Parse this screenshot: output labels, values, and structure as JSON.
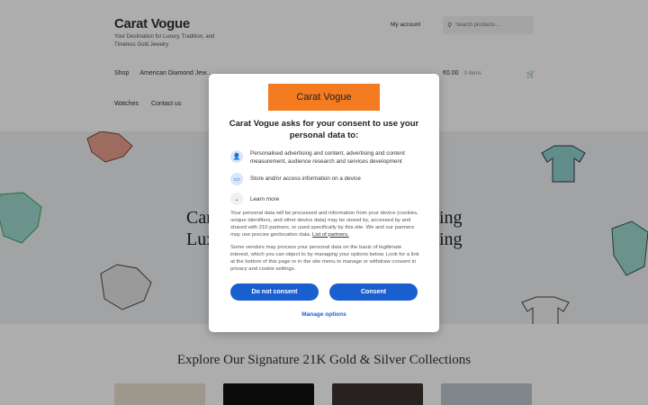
{
  "site": {
    "title": "Carat Vogue",
    "tagline": "Your Destination for Luxury, Tradition, and Timeless Gold Jewelry",
    "account": "My account",
    "search_placeholder": "Search products…"
  },
  "nav": {
    "row1": [
      "Shop",
      "American Diamond Jew…"
    ],
    "row2": [
      "Watches",
      "Contact us"
    ]
  },
  "cart": {
    "price": "€0.00",
    "items": "0 items"
  },
  "hero": {
    "line1_left": "Car",
    "line2_left": "Lux",
    "line1_right": "ing",
    "line2_right": "ing"
  },
  "explore_heading": "Explore Our Signature 21K Gold & Silver Collections",
  "consent": {
    "brand": "Carat Vogue",
    "title": "Carat Vogue asks for your consent to use your personal data to:",
    "purpose1": "Personalised advertising and content, advertising and content measurement, audience research and services development",
    "purpose2": "Store and/or access information on a device",
    "learn_more": "Learn more",
    "para1": "Your personal data will be processed and information from your device (cookies, unique identifiers, and other device data) may be stored by, accessed by and shared with 210 partners, or used specifically by this site. We and our partners may use precise geolocation data.",
    "partners_link": "List of partners.",
    "para2": "Some vendors may process your personal data on the basis of legitimate interest, which you can object to by managing your options below. Look for a link at the bottom of this page or in the site menu to manage or withdraw consent in privacy and cookie settings.",
    "btn_reject": "Do not consent",
    "btn_accept": "Consent",
    "manage": "Manage options"
  },
  "colors": {
    "brand_orange": "#f47b20",
    "button_blue": "#1a5fd0"
  }
}
